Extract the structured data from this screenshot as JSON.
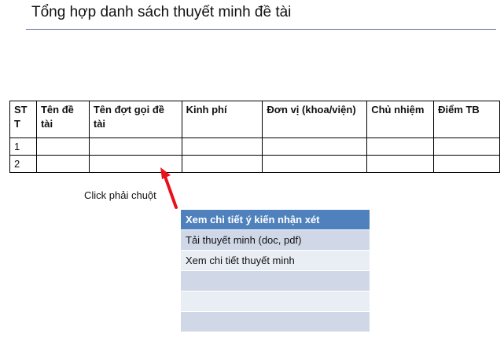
{
  "page": {
    "title": "Tổng hợp danh sách thuyết minh đề tài",
    "hint": "Click phải chuột"
  },
  "table": {
    "columns": [
      "ST T",
      "Tên đề tài",
      "Tên đợt gọi đề tài",
      "Kinh phí",
      "Đơn vị (khoa/viện)",
      "Chủ nhiệm",
      "Điểm TB"
    ],
    "rows": [
      [
        "1",
        "",
        "",
        "",
        "",
        "",
        ""
      ],
      [
        "2",
        "",
        "",
        "",
        "",
        "",
        ""
      ]
    ]
  },
  "context_menu": {
    "items": [
      "Xem chi tiết ý kiến nhận xét",
      "Tải thuyết minh (doc, pdf)",
      "Xem chi tiết thuyết minh",
      "",
      "",
      ""
    ]
  },
  "colors": {
    "menu_header": "#4f81bd",
    "menu_row_dark": "#d0d8e8",
    "menu_row_light": "#e9edf4",
    "arrow": "#e8111c"
  }
}
